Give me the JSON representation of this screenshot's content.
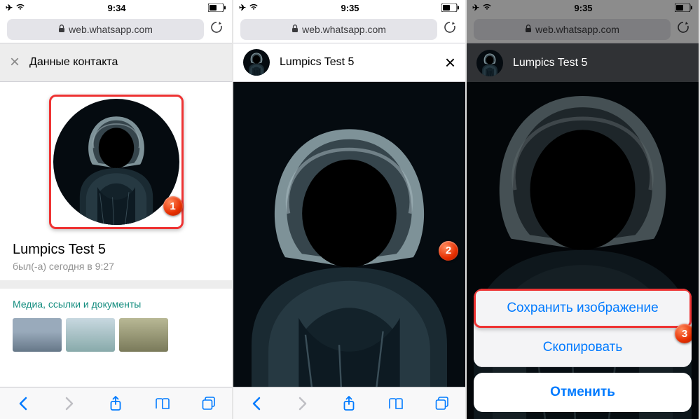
{
  "status": {
    "time1": "9:34",
    "time2": "9:35",
    "time3": "9:35"
  },
  "url": "web.whatsapp.com",
  "panel1": {
    "header": "Данные контакта",
    "name": "Lumpics Test 5",
    "status": "был(-а) сегодня в 9:27",
    "media": "Медиа, ссылки и документы"
  },
  "panel2": {
    "name": "Lumpics Test 5"
  },
  "panel3": {
    "name": "Lumpics Test 5",
    "save": "Сохранить изображение",
    "copy": "Скопировать",
    "cancel": "Отменить"
  },
  "badges": {
    "b1": "1",
    "b2": "2",
    "b3": "3"
  }
}
